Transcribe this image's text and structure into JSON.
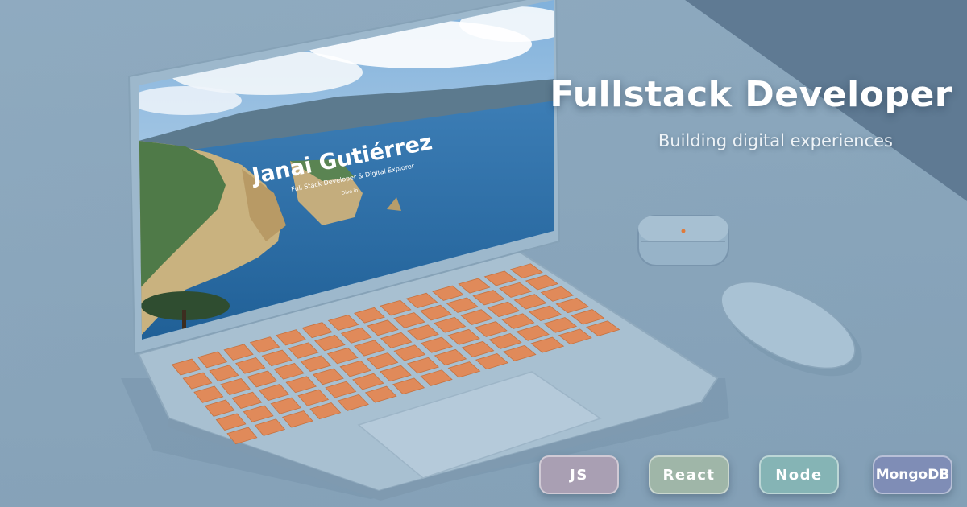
{
  "hero": {
    "title": "Fullstack Developer",
    "subtitle": "Building digital experiences"
  },
  "laptop_screen": {
    "site_title": "Janai Gutiérrez",
    "site_subtitle": "Full Stack Developer & Digital Explorer",
    "cta": "Dive in"
  },
  "tech_chips": [
    {
      "label": "JS",
      "color": "#a99fb3"
    },
    {
      "label": "React",
      "color": "#9fb6a8"
    },
    {
      "label": "Node",
      "color": "#85b4b5"
    },
    {
      "label": "MongoDB",
      "color": "#7f8db6"
    }
  ],
  "colors": {
    "background": "#8aa6bc",
    "laptop_body": "#a9c1d2",
    "keys": "#e08a5a",
    "sea": "#2e6fa8"
  }
}
